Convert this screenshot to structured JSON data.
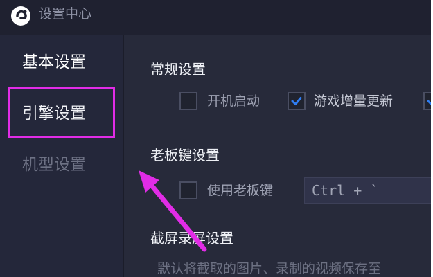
{
  "window": {
    "title": "设置中心"
  },
  "sidebar": {
    "items": [
      {
        "label": "基本设置"
      },
      {
        "label": "引擎设置"
      },
      {
        "label": "机型设置"
      }
    ]
  },
  "main": {
    "general": {
      "title": "常规设置",
      "options": [
        {
          "label": "开机启动",
          "checked": false
        },
        {
          "label": "游戏增量更新",
          "checked": true
        },
        {
          "label": "",
          "checked": true
        }
      ]
    },
    "boss_key": {
      "title": "老板键设置",
      "enable_label": "使用老板键",
      "enabled": false,
      "hotkey_value": "Ctrl + `"
    },
    "capture": {
      "title": "截屏录屏设置",
      "description": "默认将截取的图片、录制的视频保存至"
    }
  },
  "colors": {
    "window_bg": "#272a3a",
    "accent": "#2f7df2",
    "annotation": "#e12ce6"
  }
}
